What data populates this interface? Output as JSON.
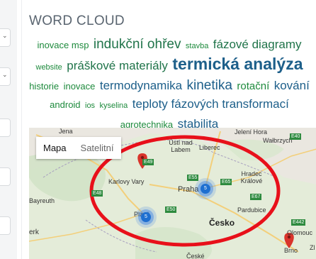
{
  "word_cloud": {
    "title": "WORD CLOUD",
    "words": [
      {
        "text": "inovace msp",
        "size": "s12"
      },
      {
        "text": "indukční ohřev",
        "size": "s18"
      },
      {
        "text": "stavba",
        "size": "s10"
      },
      {
        "text": "fázové diagramy",
        "size": "s16"
      },
      {
        "text": "website",
        "size": "s10"
      },
      {
        "text": "práškové materiály",
        "size": "s16"
      },
      {
        "text": "termická analýza",
        "size": "s22"
      },
      {
        "text": "historie",
        "size": "s12"
      },
      {
        "text": "inovace",
        "size": "s12"
      },
      {
        "text": "termodynamika",
        "size": "s16"
      },
      {
        "text": "kinetika",
        "size": "s18"
      },
      {
        "text": "rotační",
        "size": "s14"
      },
      {
        "text": "kování",
        "size": "s16"
      },
      {
        "text": "android",
        "size": "s12"
      },
      {
        "text": "ios",
        "size": "s10"
      },
      {
        "text": "kyselina",
        "size": "s10"
      },
      {
        "text": "teploty fázových transformací",
        "size": "s16"
      },
      {
        "text": "agrotechnika",
        "size": "s12"
      },
      {
        "text": "stabilita",
        "size": "s16"
      }
    ]
  },
  "map": {
    "tab_map": "Mapa",
    "tab_satellite": "Satelitní",
    "cluster_prague": "5",
    "cluster_plzen": "5",
    "places": {
      "jena": "Jena",
      "usti": "Ústí nad\nLabem",
      "liberec": "Liberec",
      "jeleni_hora": "Jelení Hora",
      "walbrzych": "Wałbrzych",
      "karlovy_vary": "Karlovy Vary",
      "hradec": "Hradec\nKrálové",
      "bayreuth": "Bayreuth",
      "praha": "Praha",
      "pardubice": "Pardubice",
      "plzen": "Plzeň",
      "cesko": "Česko",
      "erk": "erk",
      "olomouc": "Olomouc",
      "brno": "Brno",
      "zl": "Zl",
      "ceske": "České"
    },
    "roads": {
      "e40": "E40",
      "e49": "E49",
      "e55": "E55",
      "e65": "E65",
      "e50": "E50",
      "e67": "E67",
      "e442": "E442",
      "e48": "E48"
    }
  }
}
